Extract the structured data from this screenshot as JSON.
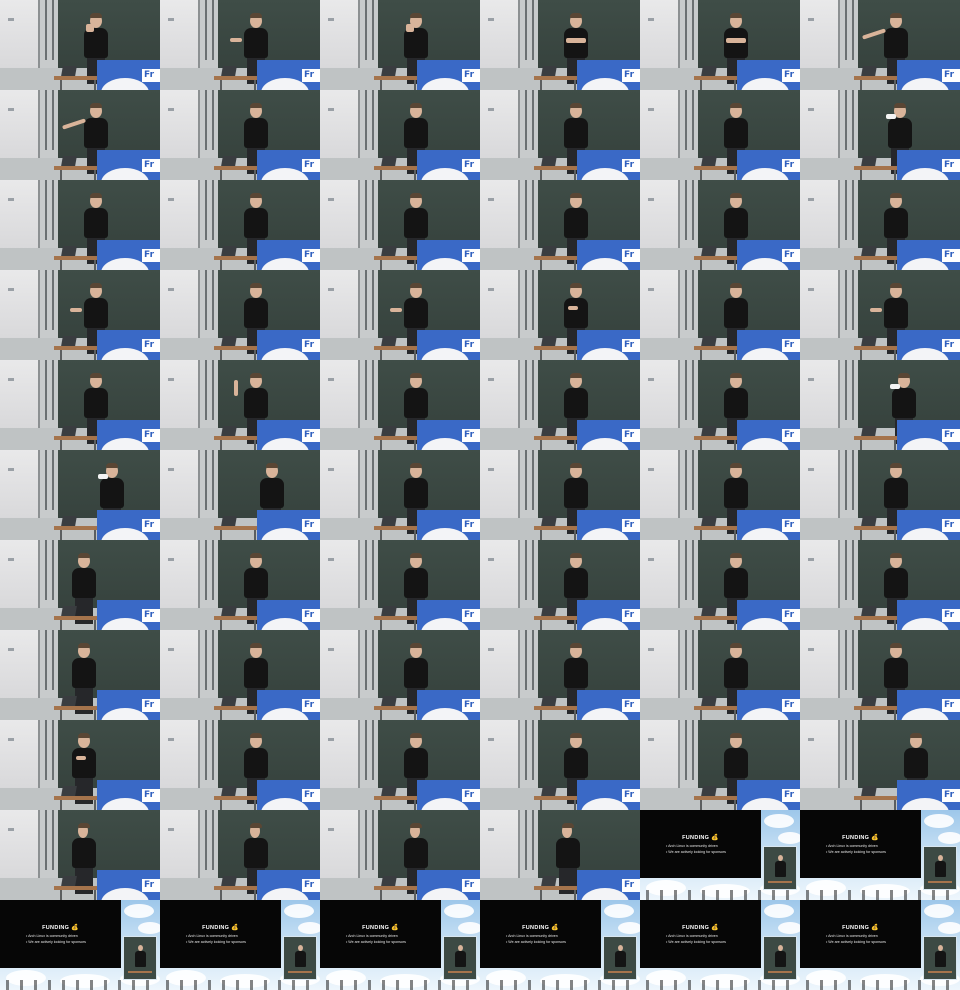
{
  "grid": {
    "columns": 6,
    "rows": 11
  },
  "stage": {
    "banner_text": "Fr"
  },
  "slide": {
    "title": "FUNDING",
    "title_emoji": "💰",
    "bullets": [
      "Arch Linux is community driven",
      "We are actively looking for sponsors"
    ]
  },
  "frames": [
    {
      "scene": "stage",
      "pose": "hand-face",
      "speaker_offset": 0.25
    },
    {
      "scene": "stage",
      "pose": "gesture",
      "speaker_offset": 0.25
    },
    {
      "scene": "stage",
      "pose": "hand-face",
      "speaker_offset": 0.25
    },
    {
      "scene": "stage",
      "pose": "arms-crossed",
      "speaker_offset": 0.25
    },
    {
      "scene": "stage",
      "pose": "arms-crossed",
      "speaker_offset": 0.25
    },
    {
      "scene": "stage",
      "pose": "point-left",
      "speaker_offset": 0.25
    },
    {
      "scene": "stage",
      "pose": "point-left",
      "speaker_offset": 0.25
    },
    {
      "scene": "stage",
      "pose": "neutral",
      "speaker_offset": 0.25
    },
    {
      "scene": "stage",
      "pose": "neutral",
      "speaker_offset": 0.25
    },
    {
      "scene": "stage",
      "pose": "neutral",
      "speaker_offset": 0.25
    },
    {
      "scene": "stage",
      "pose": "neutral",
      "speaker_offset": 0.25
    },
    {
      "scene": "stage",
      "pose": "drinking",
      "speaker_offset": 0.3
    },
    {
      "scene": "stage",
      "pose": "neutral",
      "speaker_offset": 0.25
    },
    {
      "scene": "stage",
      "pose": "neutral",
      "speaker_offset": 0.25
    },
    {
      "scene": "stage",
      "pose": "neutral",
      "speaker_offset": 0.25
    },
    {
      "scene": "stage",
      "pose": "neutral",
      "speaker_offset": 0.25
    },
    {
      "scene": "stage",
      "pose": "neutral",
      "speaker_offset": 0.25
    },
    {
      "scene": "stage",
      "pose": "neutral",
      "speaker_offset": 0.25
    },
    {
      "scene": "stage",
      "pose": "gesture",
      "speaker_offset": 0.25
    },
    {
      "scene": "stage",
      "pose": "neutral",
      "speaker_offset": 0.25
    },
    {
      "scene": "stage",
      "pose": "gesture",
      "speaker_offset": 0.25
    },
    {
      "scene": "stage",
      "pose": "hand-chest",
      "speaker_offset": 0.25
    },
    {
      "scene": "stage",
      "pose": "neutral",
      "speaker_offset": 0.25
    },
    {
      "scene": "stage",
      "pose": "gesture",
      "speaker_offset": 0.25
    },
    {
      "scene": "stage",
      "pose": "neutral",
      "speaker_offset": 0.25
    },
    {
      "scene": "stage",
      "pose": "point-up",
      "speaker_offset": 0.25
    },
    {
      "scene": "stage",
      "pose": "neutral",
      "speaker_offset": 0.25
    },
    {
      "scene": "stage",
      "pose": "neutral",
      "speaker_offset": 0.25
    },
    {
      "scene": "stage",
      "pose": "neutral",
      "speaker_offset": 0.25
    },
    {
      "scene": "stage",
      "pose": "drinking",
      "speaker_offset": 0.35
    },
    {
      "scene": "stage",
      "pose": "drinking",
      "speaker_offset": 0.45
    },
    {
      "scene": "stage",
      "pose": "neutral",
      "speaker_offset": 0.45
    },
    {
      "scene": "stage",
      "pose": "at-desk",
      "speaker_offset": 0.25
    },
    {
      "scene": "stage",
      "pose": "at-desk",
      "speaker_offset": 0.25
    },
    {
      "scene": "stage",
      "pose": "at-desk",
      "speaker_offset": 0.25
    },
    {
      "scene": "stage",
      "pose": "at-desk",
      "speaker_offset": 0.25
    },
    {
      "scene": "stage",
      "pose": "at-desk",
      "speaker_offset": 0.1
    },
    {
      "scene": "stage",
      "pose": "at-desk",
      "speaker_offset": 0.25
    },
    {
      "scene": "stage",
      "pose": "at-desk",
      "speaker_offset": 0.25
    },
    {
      "scene": "stage",
      "pose": "at-desk",
      "speaker_offset": 0.25
    },
    {
      "scene": "stage",
      "pose": "at-desk",
      "speaker_offset": 0.25
    },
    {
      "scene": "stage",
      "pose": "at-desk",
      "speaker_offset": 0.25
    },
    {
      "scene": "stage",
      "pose": "at-desk",
      "speaker_offset": 0.1
    },
    {
      "scene": "stage",
      "pose": "at-desk",
      "speaker_offset": 0.25
    },
    {
      "scene": "stage",
      "pose": "at-desk",
      "speaker_offset": 0.25
    },
    {
      "scene": "stage",
      "pose": "at-desk",
      "speaker_offset": 0.25
    },
    {
      "scene": "stage",
      "pose": "at-desk",
      "speaker_offset": 0.25
    },
    {
      "scene": "stage",
      "pose": "at-desk",
      "speaker_offset": 0.25
    },
    {
      "scene": "stage",
      "pose": "hand-chest",
      "speaker_offset": 0.1
    },
    {
      "scene": "stage",
      "pose": "at-desk",
      "speaker_offset": 0.25
    },
    {
      "scene": "stage",
      "pose": "neutral",
      "speaker_offset": 0.25
    },
    {
      "scene": "stage",
      "pose": "neutral",
      "speaker_offset": 0.25
    },
    {
      "scene": "stage",
      "pose": "neutral",
      "speaker_offset": 0.25
    },
    {
      "scene": "stage",
      "pose": "neutral",
      "speaker_offset": 0.5
    },
    {
      "scene": "stage",
      "pose": "profile",
      "speaker_offset": 0.1
    },
    {
      "scene": "stage",
      "pose": "profile",
      "speaker_offset": 0.25
    },
    {
      "scene": "stage",
      "pose": "profile",
      "speaker_offset": 0.25
    },
    {
      "scene": "stage",
      "pose": "profile",
      "speaker_offset": 0.15
    },
    {
      "scene": "slide"
    },
    {
      "scene": "slide"
    },
    {
      "scene": "slide"
    },
    {
      "scene": "slide"
    },
    {
      "scene": "slide"
    },
    {
      "scene": "slide"
    },
    {
      "scene": "slide"
    },
    {
      "scene": "slide"
    }
  ]
}
